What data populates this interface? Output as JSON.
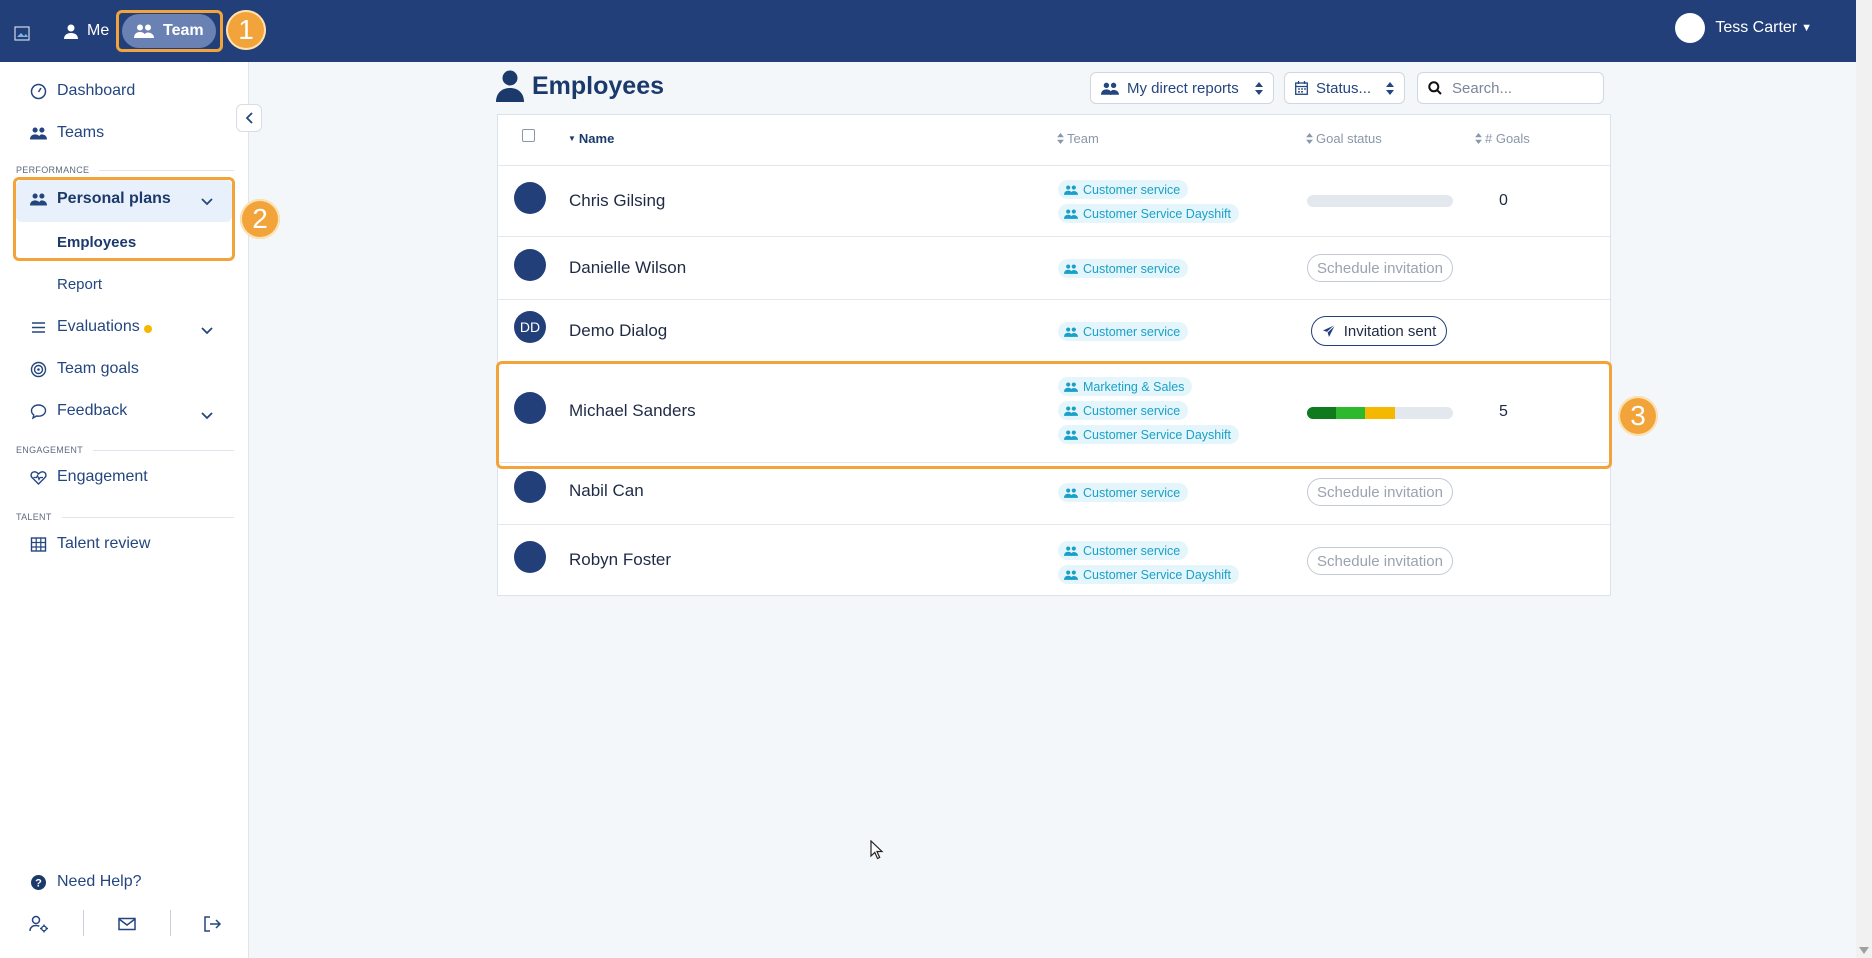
{
  "topbar": {
    "me_label": "Me",
    "team_label": "Team",
    "user_name": "Tess Carter",
    "brand_color": "#223f7a"
  },
  "callouts": [
    "1",
    "2",
    "3"
  ],
  "sidebar": {
    "dashboard": "Dashboard",
    "teams": "Teams",
    "section_performance": "PERFORMANCE",
    "personal_plans": "Personal plans",
    "employees": "Employees",
    "report": "Report",
    "evaluations": "Evaluations",
    "team_goals": "Team goals",
    "feedback": "Feedback",
    "section_engagement": "ENGAGEMENT",
    "engagement": "Engagement",
    "section_talent": "TALENT",
    "talent_review": "Talent review",
    "need_help": "Need Help?"
  },
  "page": {
    "title": "Employees",
    "filter_reports": "My direct reports",
    "filter_status": "Status...",
    "search_placeholder": "Search..."
  },
  "table": {
    "headers": {
      "name": "Name",
      "team": "Team",
      "goal_status": "Goal status",
      "goals": "# Goals"
    },
    "rows": [
      {
        "name": "Chris Gilsing",
        "initials": "",
        "teams": [
          "Customer service",
          "Customer Service Dayshift"
        ],
        "status": "progress",
        "progress": [],
        "goals": "0"
      },
      {
        "name": "Danielle Wilson",
        "initials": "",
        "teams": [
          "Customer service"
        ],
        "status": "button",
        "button_label": "Schedule invitation",
        "goals": ""
      },
      {
        "name": "Demo Dialog",
        "initials": "DD",
        "teams": [
          "Customer service"
        ],
        "status": "sent",
        "button_label": "Invitation sent",
        "goals": ""
      },
      {
        "name": "Michael Sanders",
        "initials": "",
        "teams": [
          "Marketing & Sales",
          "Customer service",
          "Customer Service Dayshift"
        ],
        "status": "progress",
        "progress": [
          {
            "fraction": 0.2,
            "color": "#0f7a1e"
          },
          {
            "fraction": 0.2,
            "color": "#2db82d"
          },
          {
            "fraction": 0.2,
            "color": "#f5b800"
          }
        ],
        "goals": "5"
      },
      {
        "name": "Nabil Can",
        "initials": "",
        "teams": [
          "Customer service"
        ],
        "status": "button",
        "button_label": "Schedule invitation",
        "goals": ""
      },
      {
        "name": "Robyn Foster",
        "initials": "",
        "teams": [
          "Customer service",
          "Customer Service Dayshift"
        ],
        "status": "button",
        "button_label": "Schedule invitation",
        "goals": ""
      }
    ]
  }
}
